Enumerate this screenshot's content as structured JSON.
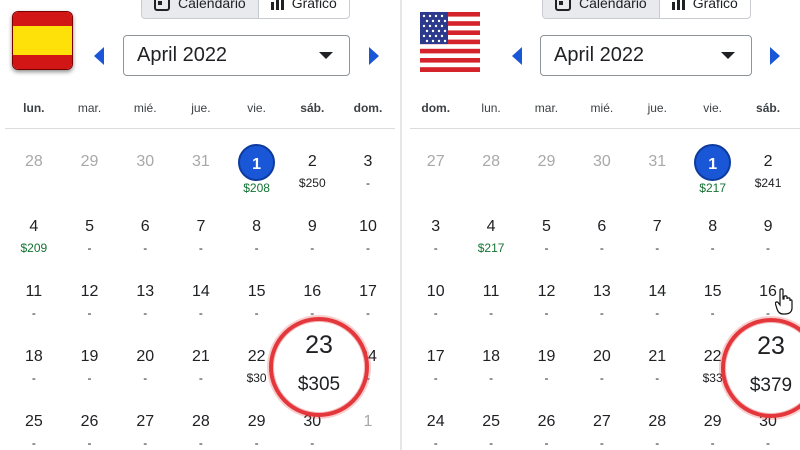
{
  "view_toggle": {
    "calendar_label": "Calendario",
    "chart_label": "Gráfico"
  },
  "colors": {
    "accent": "#1a57d6",
    "green_price": "#137333",
    "highlight_ring": "#e3373b"
  },
  "left": {
    "flag": "spain-flag",
    "month": "April 2022",
    "weekdays": [
      "lun.",
      "mar.",
      "mié.",
      "jue.",
      "vie.",
      "sáb.",
      "dom."
    ],
    "bold_weekdays": [
      0,
      5,
      6
    ],
    "weeks": [
      [
        {
          "d": "28",
          "p": "",
          "f": true
        },
        {
          "d": "29",
          "p": "",
          "f": true
        },
        {
          "d": "30",
          "p": "",
          "f": true
        },
        {
          "d": "31",
          "p": "",
          "f": true
        },
        {
          "d": "1",
          "p": "$208",
          "g": true,
          "sel": true
        },
        {
          "d": "2",
          "p": "$250"
        },
        {
          "d": "3",
          "p": "-"
        }
      ],
      [
        {
          "d": "4",
          "p": "$209",
          "g": true
        },
        {
          "d": "5",
          "p": "-"
        },
        {
          "d": "6",
          "p": "-"
        },
        {
          "d": "7",
          "p": "-"
        },
        {
          "d": "8",
          "p": "-"
        },
        {
          "d": "9",
          "p": "-"
        },
        {
          "d": "10",
          "p": "-"
        }
      ],
      [
        {
          "d": "11",
          "p": "-"
        },
        {
          "d": "12",
          "p": "-"
        },
        {
          "d": "13",
          "p": "-"
        },
        {
          "d": "14",
          "p": "-"
        },
        {
          "d": "15",
          "p": "-"
        },
        {
          "d": "16",
          "p": "-"
        },
        {
          "d": "17",
          "p": "-"
        }
      ],
      [
        {
          "d": "18",
          "p": "-"
        },
        {
          "d": "19",
          "p": "-"
        },
        {
          "d": "20",
          "p": "-"
        },
        {
          "d": "21",
          "p": "-"
        },
        {
          "d": "22",
          "p": "$30"
        },
        {
          "d": "23",
          "p": "$305"
        },
        {
          "d": "24",
          "p": "-"
        }
      ],
      [
        {
          "d": "25",
          "p": "-"
        },
        {
          "d": "26",
          "p": "-"
        },
        {
          "d": "27",
          "p": "-"
        },
        {
          "d": "28",
          "p": "-"
        },
        {
          "d": "29",
          "p": "-"
        },
        {
          "d": "30",
          "p": "-"
        },
        {
          "d": "1",
          "p": "",
          "f": true
        }
      ]
    ],
    "highlight": {
      "day": "23",
      "price": "$305"
    }
  },
  "right": {
    "flag": "usa-flag",
    "month": "April 2022",
    "weekdays": [
      "dom.",
      "lun.",
      "mar.",
      "mié.",
      "jue.",
      "vie.",
      "sáb."
    ],
    "bold_weekdays": [
      0,
      6
    ],
    "weeks": [
      [
        {
          "d": "27",
          "p": "",
          "f": true
        },
        {
          "d": "28",
          "p": "",
          "f": true
        },
        {
          "d": "29",
          "p": "",
          "f": true
        },
        {
          "d": "30",
          "p": "",
          "f": true
        },
        {
          "d": "31",
          "p": "",
          "f": true
        },
        {
          "d": "1",
          "p": "$217",
          "g": true,
          "sel": true
        },
        {
          "d": "2",
          "p": "$241"
        }
      ],
      [
        {
          "d": "3",
          "p": "-"
        },
        {
          "d": "4",
          "p": "$217",
          "g": true
        },
        {
          "d": "5",
          "p": "-"
        },
        {
          "d": "6",
          "p": "-"
        },
        {
          "d": "7",
          "p": "-"
        },
        {
          "d": "8",
          "p": "-"
        },
        {
          "d": "9",
          "p": "-"
        }
      ],
      [
        {
          "d": "10",
          "p": "-"
        },
        {
          "d": "11",
          "p": "-"
        },
        {
          "d": "12",
          "p": "-"
        },
        {
          "d": "13",
          "p": "-"
        },
        {
          "d": "14",
          "p": "-"
        },
        {
          "d": "15",
          "p": "-"
        },
        {
          "d": "16",
          "p": "-"
        }
      ],
      [
        {
          "d": "17",
          "p": "-"
        },
        {
          "d": "18",
          "p": "-"
        },
        {
          "d": "19",
          "p": "-"
        },
        {
          "d": "20",
          "p": "-"
        },
        {
          "d": "21",
          "p": "-"
        },
        {
          "d": "22",
          "p": "$33"
        },
        {
          "d": "23",
          "p": "$379"
        }
      ],
      [
        {
          "d": "24",
          "p": "-"
        },
        {
          "d": "25",
          "p": "-"
        },
        {
          "d": "26",
          "p": "-"
        },
        {
          "d": "27",
          "p": "-"
        },
        {
          "d": "28",
          "p": "-"
        },
        {
          "d": "29",
          "p": "-"
        },
        {
          "d": "30",
          "p": "-"
        }
      ]
    ],
    "highlight": {
      "day": "23",
      "price": "$379"
    }
  }
}
